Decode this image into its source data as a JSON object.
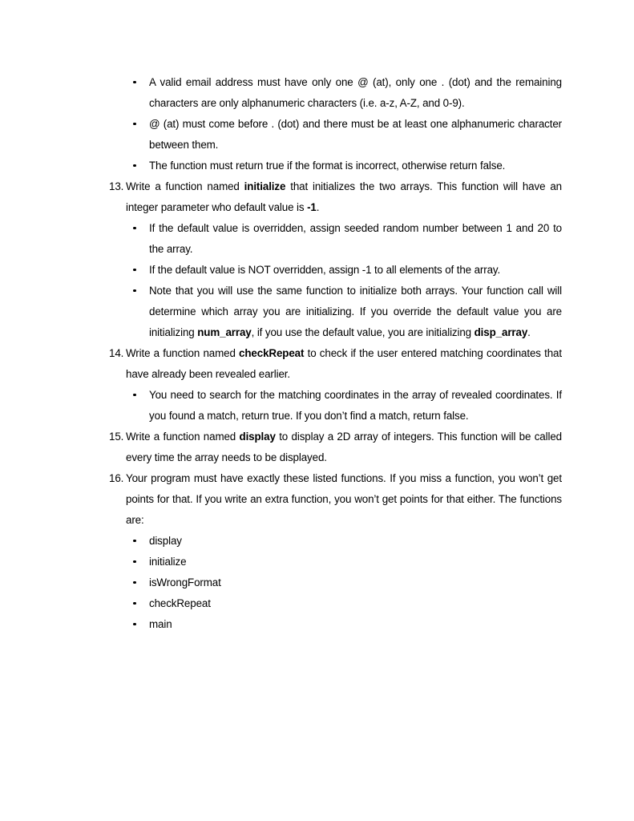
{
  "document": {
    "page_background": "#ffffff",
    "text_color": "#000000",
    "blocks": [
      {
        "kind": "bullet",
        "name": "bullet-valid-email-format",
        "justify": true,
        "runs": [
          {
            "text": "A valid email address must have only one @ (at), only one . (dot) and the remaining characters are only alphanumeric characters (i.e. a-z, A-Z, and 0-9).",
            "bold": false
          }
        ]
      },
      {
        "kind": "bullet",
        "name": "bullet-at-before-dot",
        "justify": true,
        "runs": [
          {
            "text": "@ (at) must come before . (dot) and there must be at least one alphanumeric character between them.",
            "bold": false
          }
        ]
      },
      {
        "kind": "bullet",
        "name": "bullet-return-true-if-incorrect",
        "justify": true,
        "runs": [
          {
            "text": "The function must return true if the format is incorrect, otherwise return false.",
            "bold": false
          }
        ]
      },
      {
        "kind": "numbered",
        "name": "item-13-initialize",
        "marker": "13.",
        "justify": true,
        "runs": [
          {
            "text": "Write a function named ",
            "bold": false
          },
          {
            "text": "initialize",
            "bold": true
          },
          {
            "text": " that initializes the two arrays. This function will have an integer parameter who default value is ",
            "bold": false
          },
          {
            "text": "-1",
            "bold": true
          },
          {
            "text": ".",
            "bold": false
          }
        ]
      },
      {
        "kind": "bullet",
        "name": "bullet-overridden-seeded-random",
        "justify": true,
        "runs": [
          {
            "text": "If the default value is overridden, assign seeded random number between 1 and 20 to the array.",
            "bold": false
          }
        ]
      },
      {
        "kind": "bullet",
        "name": "bullet-not-overridden-assign-minus-one",
        "justify": true,
        "runs": [
          {
            "text": "If the default value is NOT overridden, assign -1 to all elements of the array.",
            "bold": false
          }
        ]
      },
      {
        "kind": "bullet",
        "name": "bullet-same-function-both-arrays",
        "justify": true,
        "runs": [
          {
            "text": "Note that you will use the same function to initialize both arrays. Your function call will determine which array you are initializing. If you override the default value you are initializing ",
            "bold": false
          },
          {
            "text": "num_array",
            "bold": true
          },
          {
            "text": ", if you use the default value, you are initializing ",
            "bold": false
          },
          {
            "text": "disp_array",
            "bold": true
          },
          {
            "text": ".",
            "bold": false
          }
        ]
      },
      {
        "kind": "numbered",
        "name": "item-14-check-repeat",
        "marker": "14.",
        "justify": true,
        "runs": [
          {
            "text": "Write a function named ",
            "bold": false
          },
          {
            "text": "checkRepeat",
            "bold": true
          },
          {
            "text": " to check if the user entered matching coordinates that have already been revealed earlier.",
            "bold": false
          }
        ]
      },
      {
        "kind": "bullet",
        "name": "bullet-search-matching-coordinates",
        "justify": true,
        "runs": [
          {
            "text": "You need to search for the matching coordinates in the array of revealed coordinates. If you found a match, return true. If you don’t find a match, return false.",
            "bold": false
          }
        ]
      },
      {
        "kind": "numbered",
        "name": "item-15-display",
        "marker": "15.",
        "justify": true,
        "runs": [
          {
            "text": "Write a function named ",
            "bold": false
          },
          {
            "text": "display",
            "bold": true
          },
          {
            "text": " to display a 2D array of integers. This function will be called every time the array needs to be displayed.",
            "bold": false
          }
        ]
      },
      {
        "kind": "numbered",
        "name": "item-16-exact-function-list",
        "marker": "16.",
        "justify": true,
        "runs": [
          {
            "text": "Your program must have exactly these listed functions. If you miss a function, you won’t get points for that. If you write an extra function, you won’t get points for that either. The functions are:",
            "bold": false
          }
        ]
      },
      {
        "kind": "bullet",
        "name": "bullet-function-display",
        "justify": false,
        "runs": [
          {
            "text": "display",
            "bold": false
          }
        ]
      },
      {
        "kind": "bullet",
        "name": "bullet-function-initialize",
        "justify": false,
        "runs": [
          {
            "text": "initialize",
            "bold": false
          }
        ]
      },
      {
        "kind": "bullet",
        "name": "bullet-function-iswrongformat",
        "justify": false,
        "runs": [
          {
            "text": "isWrongFormat",
            "bold": false
          }
        ]
      },
      {
        "kind": "bullet",
        "name": "bullet-function-checkrepeat",
        "justify": false,
        "runs": [
          {
            "text": "checkRepeat",
            "bold": false
          }
        ]
      },
      {
        "kind": "bullet",
        "name": "bullet-function-main",
        "justify": false,
        "runs": [
          {
            "text": "main",
            "bold": false
          }
        ]
      }
    ]
  }
}
